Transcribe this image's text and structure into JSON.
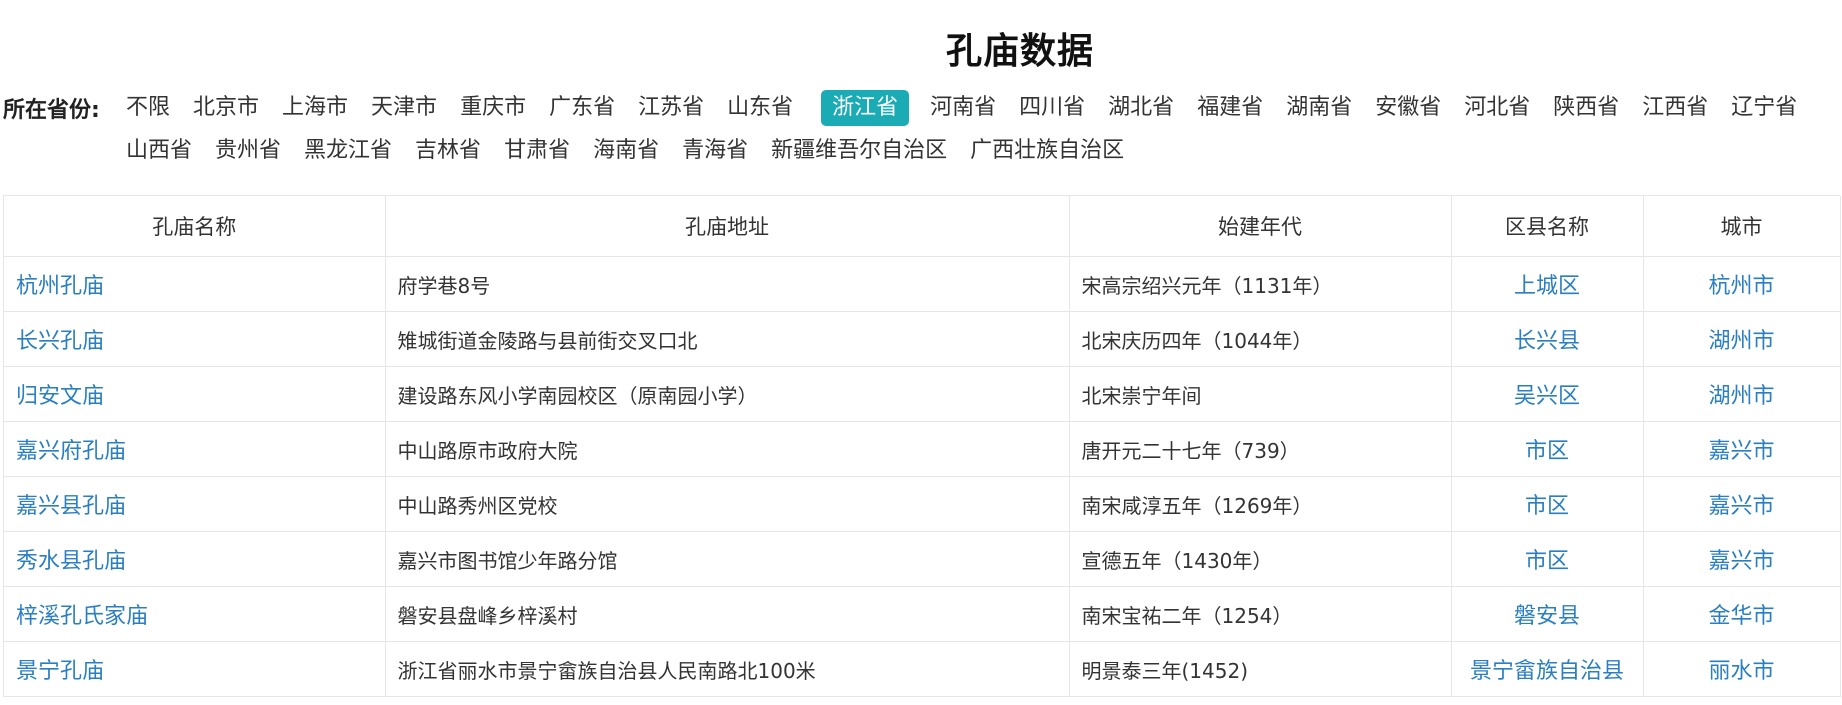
{
  "page": {
    "title": "孔庙数据"
  },
  "filter": {
    "label": "所在省份:",
    "row1": [
      "不限",
      "北京市",
      "上海市",
      "天津市",
      "重庆市",
      "广东省",
      "江苏省",
      "山东省",
      "浙江省",
      "河南省",
      "四川省",
      "湖北省",
      "福建省",
      "湖南省",
      "安徽省",
      "河北省",
      "陕西省",
      "江西省",
      "辽宁省"
    ],
    "row2": [
      "山西省",
      "贵州省",
      "黑龙江省",
      "吉林省",
      "甘肃省",
      "海南省",
      "青海省",
      "新疆维吾尔自治区",
      "广西壮族自治区"
    ],
    "selected": "浙江省",
    "active_color": "#1aabb5"
  },
  "table": {
    "headers": [
      "孔庙名称",
      "孔庙地址",
      "始建年代",
      "区县名称",
      "城市"
    ],
    "rows": [
      {
        "name": "杭州孔庙",
        "address": "府学巷8号",
        "year": "宋高宗绍兴元年（1131年）",
        "district": "上城区",
        "city": "杭州市"
      },
      {
        "name": "长兴孔庙",
        "address": "雉城街道金陵路与县前街交叉口北",
        "year": "北宋庆历四年（1044年）",
        "district": "长兴县",
        "city": "湖州市"
      },
      {
        "name": "归安文庙",
        "address": "建设路东风小学南园校区（原南园小学）",
        "year": "北宋崇宁年间",
        "district": "吴兴区",
        "city": "湖州市"
      },
      {
        "name": "嘉兴府孔庙",
        "address": "中山路原市政府大院",
        "year": "唐开元二十七年（739）",
        "district": "市区",
        "city": "嘉兴市"
      },
      {
        "name": "嘉兴县孔庙",
        "address": "中山路秀州区党校",
        "year": "南宋咸淳五年（1269年）",
        "district": "市区",
        "city": "嘉兴市"
      },
      {
        "name": "秀水县孔庙",
        "address": "嘉兴市图书馆少年路分馆",
        "year": "宣德五年（1430年）",
        "district": "市区",
        "city": "嘉兴市"
      },
      {
        "name": "梓溪孔氏家庙",
        "address": "磐安县盘峰乡梓溪村",
        "year": "南宋宝祐二年（1254）",
        "district": "磐安县",
        "city": "金华市"
      },
      {
        "name": "景宁孔庙",
        "address": "浙江省丽水市景宁畲族自治县人民南路北100米",
        "year": "明景泰三年(1452)",
        "district": "景宁畲族自治县",
        "city": "丽水市"
      }
    ]
  },
  "colors": {
    "link": "#2a7ec2",
    "border": "#e6e6e6"
  }
}
